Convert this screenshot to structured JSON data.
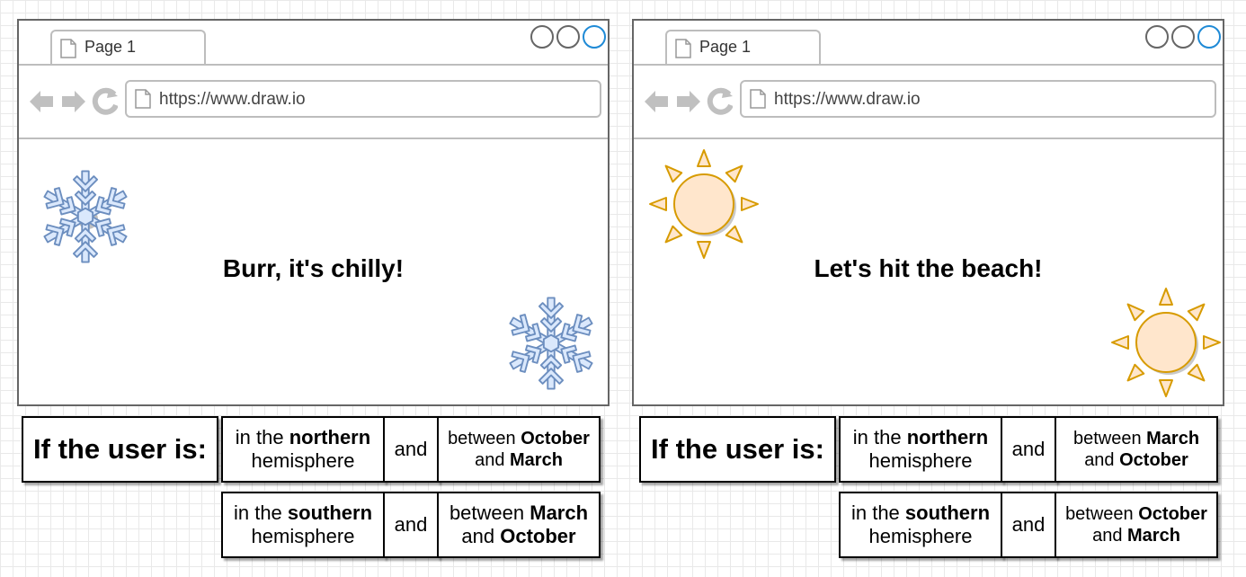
{
  "panels": [
    {
      "tab_label": "Page 1",
      "url": "https://www.draw.io",
      "message": "Burr, it's chilly!",
      "icon": "snowflake-icon",
      "rule_label": "If the user is:",
      "rows": [
        {
          "loc_pre": "in the ",
          "loc_bold": "northern",
          "loc_post": "hemisphere",
          "and": "and",
          "between": "between",
          "from": "October",
          "conj": "and",
          "to": "March"
        },
        {
          "loc_pre": "in the ",
          "loc_bold": "southern",
          "loc_post": "hemisphere",
          "and": "and",
          "between": "between",
          "from": "March",
          "conj": "and",
          "to": "October"
        }
      ]
    },
    {
      "tab_label": "Page 1",
      "url": "https://www.draw.io",
      "message": "Let's hit the beach!",
      "icon": "sun-icon",
      "rule_label": "If the user is:",
      "rows": [
        {
          "loc_pre": "in the ",
          "loc_bold": "northern",
          "loc_post": "hemisphere",
          "and": "and",
          "between": "between",
          "from": "March",
          "conj": "and",
          "to": "October"
        },
        {
          "loc_pre": "in the ",
          "loc_bold": "southern",
          "loc_post": "hemisphere",
          "and": "and",
          "between": "between",
          "from": "October",
          "conj": "and",
          "to": "March"
        }
      ]
    }
  ],
  "colors": {
    "snowflake_fill": "#dae8fc",
    "snowflake_stroke": "#6c8ebf",
    "sun_fill": "#ffe6cc",
    "sun_stroke": "#d79b00",
    "accent_blue": "#1f8ad6"
  }
}
